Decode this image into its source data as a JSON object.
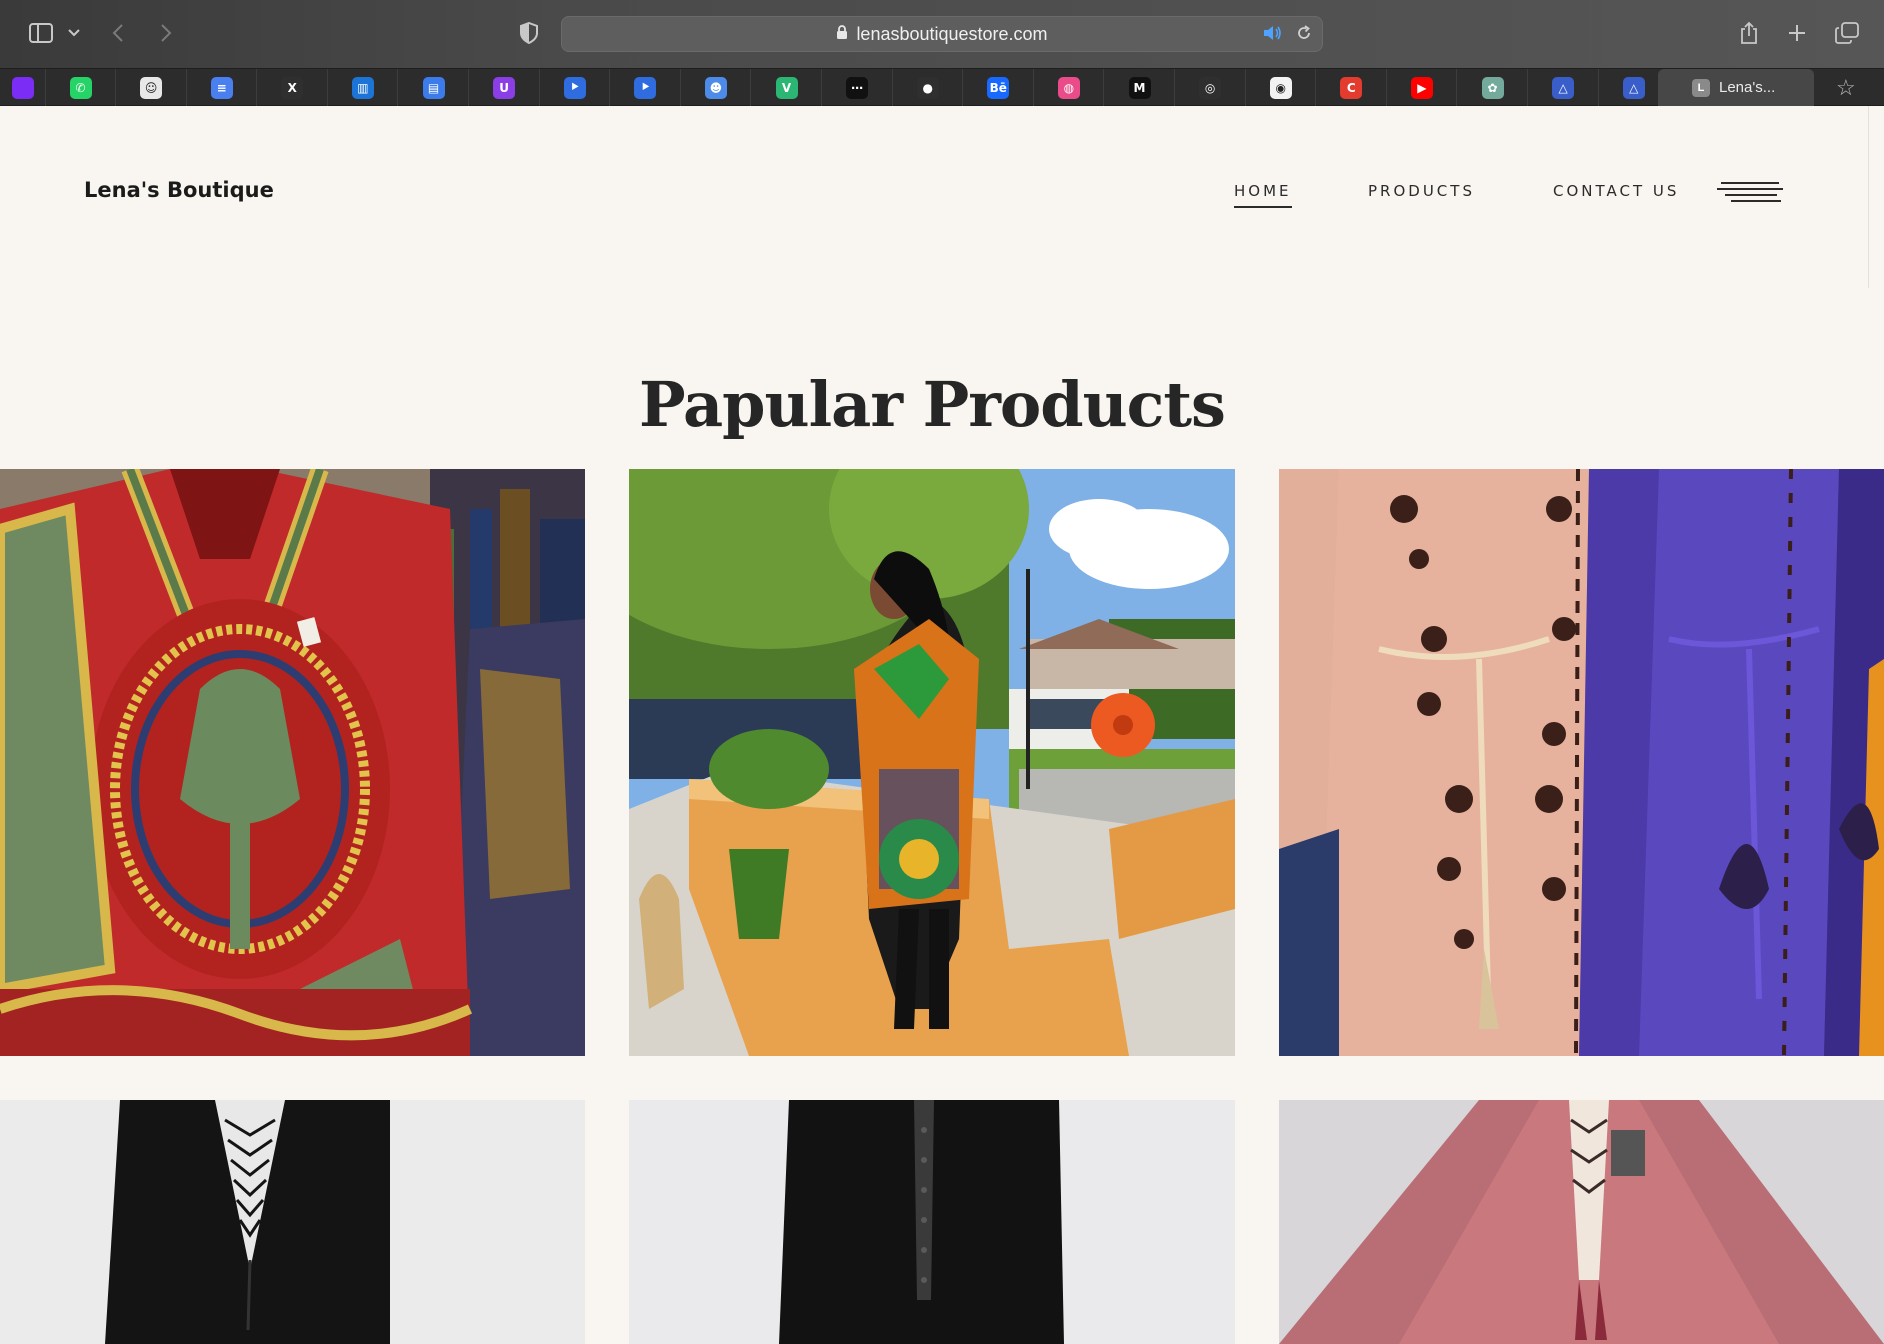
{
  "browser": {
    "url": "lenasboutiquestore.com",
    "active_tab_label": "Lena's...",
    "active_tab_favicon": "L",
    "pinned_tabs": [
      {
        "name": "vivaldi-icon",
        "color": "#7b2cf5",
        "glyph": ""
      },
      {
        "name": "whatsapp-icon",
        "color": "#25d366",
        "glyph": "✆"
      },
      {
        "name": "smiley-icon",
        "color": "#e8e8e8",
        "glyph": "☺"
      },
      {
        "name": "docs-icon",
        "color": "#4a7ff0",
        "glyph": "≡"
      },
      {
        "name": "x-icon",
        "color": "#2f2f2f",
        "glyph": "X"
      },
      {
        "name": "trello-icon",
        "color": "#1c74d6",
        "glyph": "▥"
      },
      {
        "name": "notes-icon",
        "color": "#3c7bea",
        "glyph": "▤"
      },
      {
        "name": "u-icon",
        "color": "#8b3ee6",
        "glyph": "U"
      },
      {
        "name": "jira-icon",
        "color": "#2e6ce0",
        "glyph": "⯈"
      },
      {
        "name": "jira-icon",
        "color": "#2e6ce0",
        "glyph": "⯈"
      },
      {
        "name": "bot-icon",
        "color": "#4d8be8",
        "glyph": "☻"
      },
      {
        "name": "v-icon",
        "color": "#2bb673",
        "glyph": "V"
      },
      {
        "name": "dots-icon",
        "color": "#111111",
        "glyph": "⋯"
      },
      {
        "name": "bird-icon",
        "color": "#2f2f2f",
        "glyph": "●"
      },
      {
        "name": "behance-icon",
        "color": "#1769ff",
        "glyph": "Bē"
      },
      {
        "name": "dribbble-icon",
        "color": "#ea4c89",
        "glyph": "◍"
      },
      {
        "name": "medium-icon",
        "color": "#111111",
        "glyph": "M"
      },
      {
        "name": "globe-icon",
        "color": "#2f2f2f",
        "glyph": "◎"
      },
      {
        "name": "circle-icon",
        "color": "#f2f2f2",
        "glyph": "◉"
      },
      {
        "name": "c-icon",
        "color": "#e33b2e",
        "glyph": "C"
      },
      {
        "name": "youtube-icon",
        "color": "#ff0000",
        "glyph": "▶"
      },
      {
        "name": "chatgpt-icon",
        "color": "#74aa9c",
        "glyph": "✿"
      },
      {
        "name": "triangle-icon",
        "color": "#3a5ec9",
        "glyph": "△"
      },
      {
        "name": "triangle-icon",
        "color": "#3a5ec9",
        "glyph": "△"
      }
    ]
  },
  "site": {
    "title": "Lena's Boutique",
    "nav": {
      "home": "HOME",
      "products": "PRODUCTS",
      "contact": "CONTACT US"
    }
  },
  "section": {
    "heading": "Papular Products"
  },
  "products": [
    {
      "name": "product-red-dashiki-shirt"
    },
    {
      "name": "product-african-print-dress-outdoor"
    },
    {
      "name": "product-embroidered-abayas-peach-purple"
    },
    {
      "name": "product-black-abaya-chevron-trim"
    },
    {
      "name": "product-black-abaya-beaded-trim"
    },
    {
      "name": "product-rose-kaftan-beaded-necklace"
    }
  ]
}
